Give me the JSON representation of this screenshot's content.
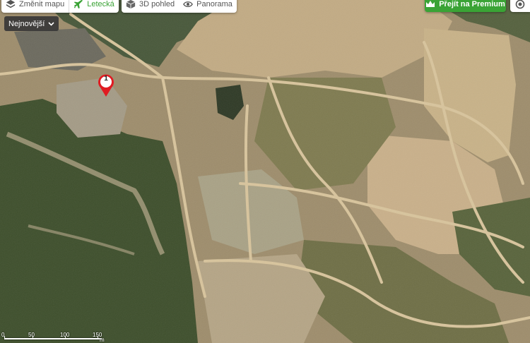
{
  "toolbar": {
    "change_map_label": "Změnit mapu",
    "aerial_label": "Letecká",
    "view3d_label": "3D pohled",
    "panorama_label": "Panorama",
    "premium_label": "Přejít na Premium"
  },
  "sort": {
    "label": "Nejnovější"
  },
  "marker": {
    "label": "1"
  },
  "scale": {
    "labels": [
      "0",
      "50",
      "100",
      "150"
    ],
    "unit": "m"
  },
  "colors": {
    "accent": "#3aa335",
    "marker": "#e01b22"
  },
  "icons": [
    "layers-icon",
    "plane-icon",
    "cube-icon",
    "eye-icon",
    "crown-icon",
    "locate-icon",
    "chevron-down-icon"
  ]
}
